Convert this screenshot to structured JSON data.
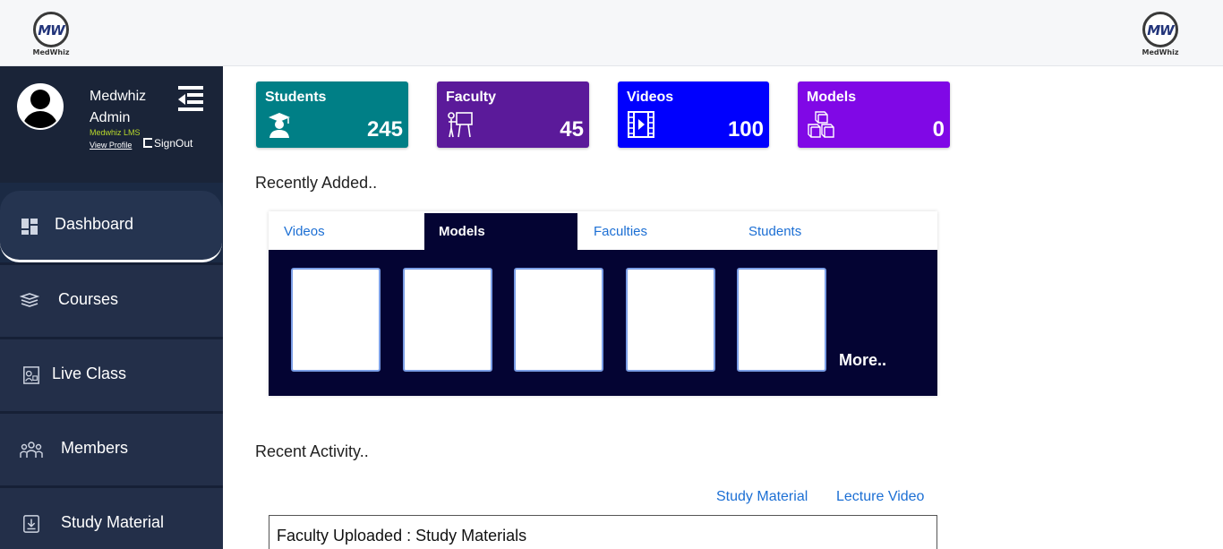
{
  "header": {
    "logo_text": "MW",
    "logo_label": "MedWhiz"
  },
  "profile": {
    "name_line1": "Medwhiz",
    "name_line2": "Admin",
    "subtitle": "Medwhiz LMS",
    "view_profile": "View Profile",
    "signout": "SignOut"
  },
  "sidebar": {
    "items": [
      {
        "label": "Dashboard",
        "icon": "dashboard-icon",
        "active": true
      },
      {
        "label": "Courses",
        "icon": "books-icon"
      },
      {
        "label": "Live Class",
        "icon": "live-class-icon"
      },
      {
        "label": "Members",
        "icon": "members-icon"
      },
      {
        "label": "Study Material",
        "icon": "study-material-icon"
      }
    ]
  },
  "stats": [
    {
      "title": "Students",
      "value": "245",
      "icon": "graduate-icon",
      "color": "#007f86"
    },
    {
      "title": "Faculty",
      "value": "45",
      "icon": "teacher-board-icon",
      "color": "#5b1a9a"
    },
    {
      "title": "Videos",
      "value": "100",
      "icon": "film-play-icon",
      "color": "#0000fe"
    },
    {
      "title": "Models",
      "value": "0",
      "icon": "cubes-icon",
      "color": "#8008e6"
    }
  ],
  "recent": {
    "title": "Recently Added..",
    "tabs": [
      "Videos",
      "Models",
      "Faculties",
      "Students"
    ],
    "active_tab": "Models",
    "more": "More.."
  },
  "activity": {
    "title": "Recent Activity..",
    "links": [
      "Study Material",
      "Lecture Video"
    ],
    "first_entry": "Faculty Uploaded : Study Materials"
  }
}
